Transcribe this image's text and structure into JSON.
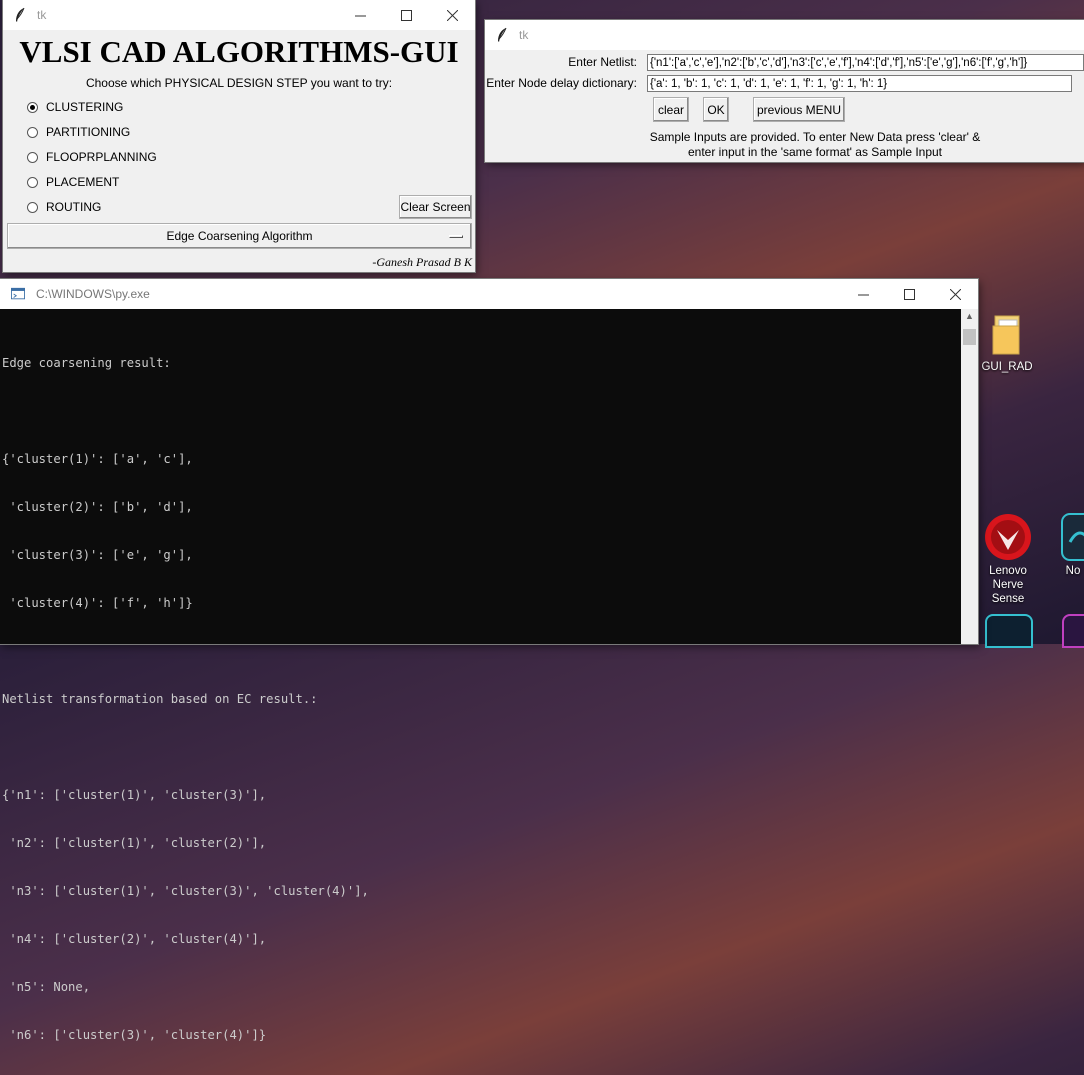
{
  "window1": {
    "title": "tk",
    "heading": "VLSI CAD ALGORITHMS-GUI",
    "prompt": "Choose which PHYSICAL DESIGN STEP you want to try:",
    "options": [
      {
        "label": "CLUSTERING",
        "selected": true
      },
      {
        "label": "PARTITIONING",
        "selected": false
      },
      {
        "label": "FLOOPRPLANNING",
        "selected": false
      },
      {
        "label": "PLACEMENT",
        "selected": false
      },
      {
        "label": "ROUTING",
        "selected": false
      }
    ],
    "clear_screen_label": "Clear Screen",
    "algorithm_menu_label": "Edge Coarsening Algorithm",
    "author": "-Ganesh Prasad B K"
  },
  "window2": {
    "title": "tk",
    "netlist_label": "Enter Netlist:",
    "netlist_value": "{'n1':['a','c','e'],'n2':['b','c','d'],'n3':['c','e','f'],'n4':['d','f'],'n5':['e','g'],'n6':['f','g','h']}",
    "delay_label": "Enter Node delay dictionary:",
    "delay_value": "{'a': 1, 'b': 1, 'c': 1, 'd': 1, 'e': 1, 'f': 1, 'g': 1, 'h': 1}",
    "clear_label": "clear",
    "ok_label": "OK",
    "previous_label": "previous MENU",
    "note_line1": "Sample Inputs are provided. To enter New Data press 'clear' &",
    "note_line2": "enter input in the 'same format' as Sample Input"
  },
  "console": {
    "title": "C:\\WINDOWS\\py.exe",
    "lines": [
      "Edge coarsening result:",
      "",
      "{'cluster(1)': ['a', 'c'],",
      " 'cluster(2)': ['b', 'd'],",
      " 'cluster(3)': ['e', 'g'],",
      " 'cluster(4)': ['f', 'h']}",
      "",
      "Netlist transformation based on EC result.:",
      "",
      "{'n1': ['cluster(1)', 'cluster(3)'],",
      " 'n2': ['cluster(1)', 'cluster(2)'],",
      " 'n3': ['cluster(1)', 'cluster(3)', 'cluster(4)'],",
      " 'n4': ['cluster(2)', 'cluster(4)'],",
      " 'n5': None,",
      " 'n6': ['cluster(3)', 'cluster(4)']}"
    ]
  },
  "desktop": {
    "icons": [
      {
        "label": "GUI_RAD",
        "icon": "folder-icon"
      },
      {
        "label": "Lenovo Nerve Sense",
        "icon": "lenovo-nerve-sense-icon"
      },
      {
        "label": "No",
        "icon": "app-icon"
      }
    ]
  },
  "colors": {
    "console_bg": "#0c0c0c",
    "console_text": "#cccccc",
    "window_bg": "#f0f0f0"
  }
}
